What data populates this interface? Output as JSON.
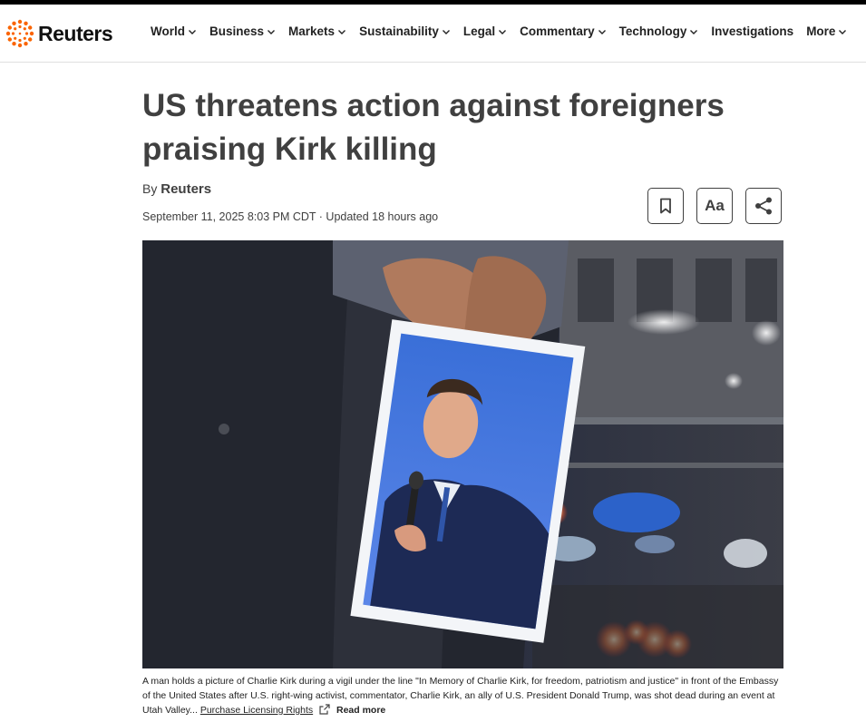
{
  "brand": {
    "name": "Reuters",
    "accent": "#fa6400"
  },
  "nav": {
    "items": [
      {
        "label": "World",
        "has_menu": true
      },
      {
        "label": "Business",
        "has_menu": true
      },
      {
        "label": "Markets",
        "has_menu": true
      },
      {
        "label": "Sustainability",
        "has_menu": true
      },
      {
        "label": "Legal",
        "has_menu": true
      },
      {
        "label": "Commentary",
        "has_menu": true
      },
      {
        "label": "Technology",
        "has_menu": true
      },
      {
        "label": "Investigations",
        "has_menu": false
      },
      {
        "label": "More",
        "has_menu": true
      }
    ]
  },
  "article": {
    "headline": "US threatens action against foreigners praising Kirk killing",
    "by_prefix": "By",
    "author": "Reuters",
    "date": "September 11, 2025 8:03 PM CDT · Updated 18 hours ago",
    "tools": {
      "bookmark_icon": "bookmark-icon",
      "text_size_label": "Aa",
      "share_icon": "share-icon"
    },
    "caption": {
      "text": "A man holds a picture of Charlie Kirk during a vigil under the line \"In Memory of Charlie Kirk, for freedom, patriotism and justice\" in front of the Embassy of the United States after U.S. right-wing activist, commentator, Charlie Kirk, an ally of U.S. President Donald Trump, was shot dead during an event at Utah Valley...",
      "licensing_link": "Purchase Licensing Rights",
      "read_more": "Read more"
    }
  }
}
